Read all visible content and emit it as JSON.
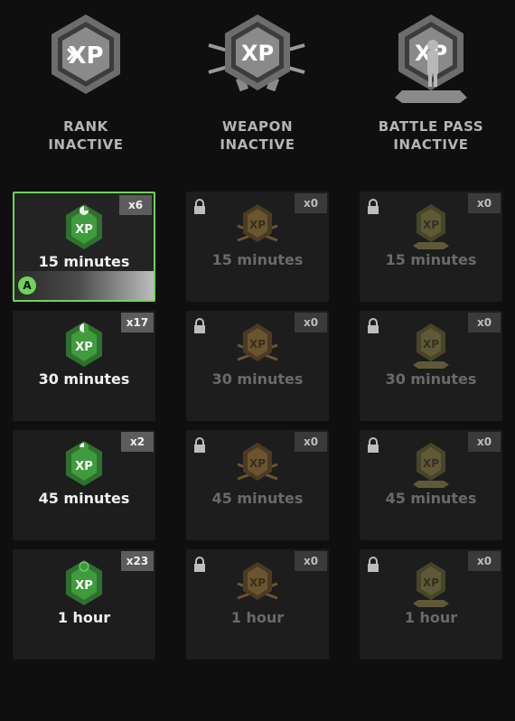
{
  "header": {
    "columns": [
      {
        "label_line1": "RANK",
        "label_line2": "INACTIVE",
        "icon": "xp-rank-icon"
      },
      {
        "label_line1": "WEAPON",
        "label_line2": "INACTIVE",
        "icon": "xp-weapon-icon"
      },
      {
        "label_line1": "BATTLE PASS",
        "label_line2": "INACTIVE",
        "icon": "xp-battlepass-icon"
      }
    ]
  },
  "colors": {
    "accent_green": "#6fd35a",
    "rank_icon_green": "#3f9c3c",
    "weapon_icon_locked": "#6b5530",
    "battlepass_icon_locked": "#5e5a38"
  },
  "tokens": {
    "rank": [
      {
        "duration": "15 minutes",
        "count": "x6",
        "selected": true,
        "action_key": "A"
      },
      {
        "duration": "30 minutes",
        "count": "x17"
      },
      {
        "duration": "45 minutes",
        "count": "x2"
      },
      {
        "duration": "1 hour",
        "count": "x23"
      }
    ],
    "weapon": [
      {
        "duration": "15 minutes",
        "count": "x0",
        "locked": true
      },
      {
        "duration": "30 minutes",
        "count": "x0",
        "locked": true
      },
      {
        "duration": "45 minutes",
        "count": "x0",
        "locked": true
      },
      {
        "duration": "1 hour",
        "count": "x0",
        "locked": true
      }
    ],
    "battle_pass": [
      {
        "duration": "15 minutes",
        "count": "x0",
        "locked": true
      },
      {
        "duration": "30 minutes",
        "count": "x0",
        "locked": true
      },
      {
        "duration": "45 minutes",
        "count": "x0",
        "locked": true
      },
      {
        "duration": "1 hour",
        "count": "x0",
        "locked": true
      }
    ]
  }
}
